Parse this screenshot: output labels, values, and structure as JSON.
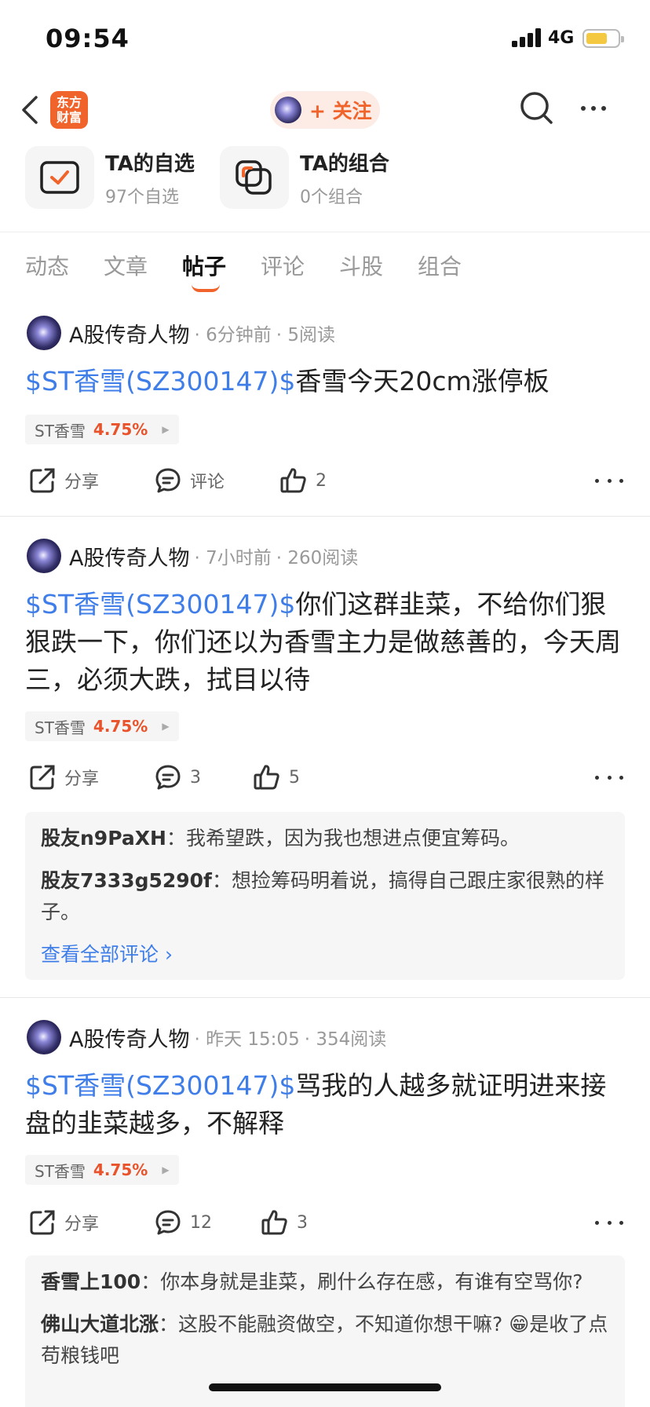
{
  "status_bar": {
    "time": "09:54",
    "network": "4G",
    "battery_level": 0.55
  },
  "header": {
    "app_logo": "东方\n财富",
    "follow_label": "+ 关注",
    "icons": [
      "back-icon",
      "search-icon",
      "more-icon"
    ]
  },
  "shortcuts": [
    {
      "title": "TA的自选",
      "subtitle": "97个自选",
      "icon": "watchlist-check-icon"
    },
    {
      "title": "TA的组合",
      "subtitle": "0个组合",
      "icon": "portfolio-icon"
    }
  ],
  "tabs": [
    "动态",
    "文章",
    "帖子",
    "评论",
    "斗股",
    "组合"
  ],
  "active_tab": "帖子",
  "posts": [
    {
      "author": "A股传奇人物",
      "time": "· 6分钟前",
      "reads": "· 5阅读",
      "cashtag": "$ST香雪(SZ300147)$",
      "text": "香雪今天20cm涨停板",
      "stock_name": "ST香雪",
      "stock_change": "4.75%",
      "share_label": "分享",
      "comment_label": "评论",
      "likes": "2"
    },
    {
      "author": "A股传奇人物",
      "time": "· 7小时前",
      "reads": "· 260阅读",
      "cashtag": "$ST香雪(SZ300147)$",
      "text": "你们这群韭菜，不给你们狠狠跌一下，你们还以为香雪主力是做慈善的，今天周三，必须大跌，拭目以待",
      "stock_name": "ST香雪",
      "stock_change": "4.75%",
      "share_label": "分享",
      "comment_label": "3",
      "likes": "5",
      "comments": [
        {
          "user": "股友n9PaXH",
          "sep": "：",
          "text": "我希望跌，因为我也想进点便宜筹码。"
        },
        {
          "user": "股友7333g5290f",
          "sep": "：",
          "text": "想捡筹码明着说，搞得自己跟庄家很熟的样子。"
        }
      ],
      "view_all": "查看全部评论 ›"
    },
    {
      "author": "A股传奇人物",
      "time": "· 昨天 15:05",
      "reads": "· 354阅读",
      "cashtag": "$ST香雪(SZ300147)$",
      "text": "骂我的人越多就证明进来接盘的韭菜越多，不解释",
      "stock_name": "ST香雪",
      "stock_change": "4.75%",
      "share_label": "分享",
      "comment_label": "12",
      "likes": "3",
      "comments": [
        {
          "user": "香雪上100",
          "sep": "：",
          "text": "你本身就是韭菜，刷什么存在感，有谁有空骂你?"
        },
        {
          "user": "佛山大道北涨",
          "sep": "：",
          "text": "这股不能融资做空，不知道你想干嘛? 😁是收了点苟粮钱吧"
        }
      ]
    }
  ]
}
